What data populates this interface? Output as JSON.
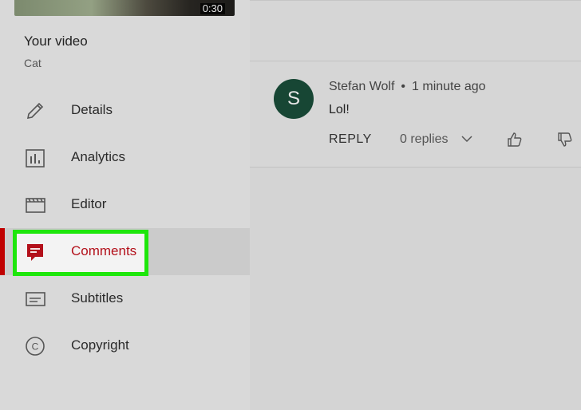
{
  "video": {
    "duration": "0:30",
    "title": "Your video",
    "subtitle": "Cat"
  },
  "sidebar": {
    "items": [
      {
        "label": "Details",
        "icon": "pencil-icon"
      },
      {
        "label": "Analytics",
        "icon": "analytics-icon"
      },
      {
        "label": "Editor",
        "icon": "editor-clapper-icon"
      },
      {
        "label": "Comments",
        "icon": "comments-icon",
        "active": true
      },
      {
        "label": "Subtitles",
        "icon": "subtitles-icon"
      },
      {
        "label": "Copyright",
        "icon": "copyright-icon"
      }
    ],
    "active_color": "#c00000",
    "highlight_color": "#1ee60c"
  },
  "comment": {
    "avatar_letter": "S",
    "avatar_color": "#174634",
    "author": "Stefan Wolf",
    "separator": "•",
    "time": "1 minute ago",
    "text": "Lol!",
    "reply_label": "REPLY",
    "replies_label": "0 replies"
  }
}
